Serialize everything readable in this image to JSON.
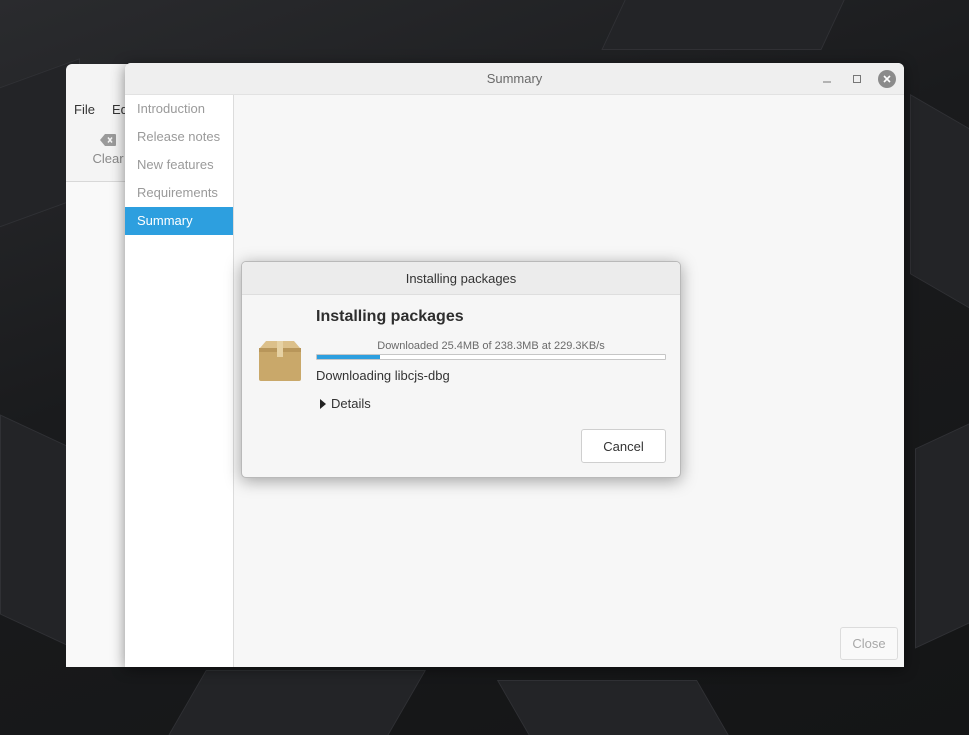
{
  "background_window": {
    "menu": [
      "File",
      "Ed"
    ],
    "clear_label": "Clear"
  },
  "main_window": {
    "title": "Summary",
    "sidebar": {
      "items": [
        {
          "label": "Introduction"
        },
        {
          "label": "Release notes"
        },
        {
          "label": "New features"
        },
        {
          "label": "Requirements"
        },
        {
          "label": "Summary"
        }
      ],
      "active_index": 4
    },
    "close_label": "Close"
  },
  "dialog": {
    "title": "Installing packages",
    "heading": "Installing packages",
    "progress_text": "Downloaded 25.4MB of 238.3MB at 229.3KB/s",
    "progress_fraction": 0.18,
    "status": "Downloading libcjs-dbg",
    "details_label": "Details",
    "cancel_label": "Cancel"
  },
  "icons": {
    "package": "package-icon",
    "clear": "clear-icon",
    "minimize": "minimize-icon",
    "maximize": "maximize-icon",
    "close": "close-icon",
    "expander": "triangle-right-icon"
  },
  "colors": {
    "accent": "#2d9fdf",
    "package_box": "#c9a86a"
  }
}
